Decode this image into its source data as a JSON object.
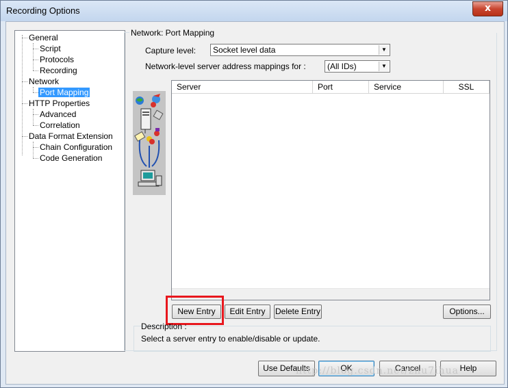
{
  "window": {
    "title": "Recording Options",
    "close_glyph": "x"
  },
  "tree": {
    "items": [
      {
        "label": "General"
      },
      {
        "label": "Script"
      },
      {
        "label": "Protocols"
      },
      {
        "label": "Recording"
      },
      {
        "label": "Network"
      },
      {
        "label": "Port Mapping",
        "selected": true
      },
      {
        "label": "HTTP Properties"
      },
      {
        "label": "Advanced"
      },
      {
        "label": "Correlation"
      },
      {
        "label": "Data Format Extension"
      },
      {
        "label": "Chain Configuration"
      },
      {
        "label": "Code Generation"
      }
    ]
  },
  "section": {
    "title": "Network: Port Mapping"
  },
  "capture": {
    "label": "Capture level:",
    "value": "Socket level data"
  },
  "mapping": {
    "label": "Network-level server address mappings for :",
    "value": "(All IDs)"
  },
  "list": {
    "columns": [
      "Server",
      "Port",
      "Service",
      "SSL"
    ],
    "rows": []
  },
  "buttons": {
    "new_entry": "New Entry",
    "edit_entry": "Edit Entry",
    "delete_entry": "Delete Entry",
    "options": "Options..."
  },
  "description": {
    "label": "Description :",
    "text": "Select a server entry to enable/disable or update."
  },
  "footer": {
    "use_defaults": "Use Defaults",
    "ok": "OK",
    "cancel": "Cancel",
    "help": "Help"
  },
  "watermark": "http://blog.csdn.net/zhu7ihua",
  "colors": {
    "selection": "#3399ff",
    "highlight_box": "#e8171d",
    "close_button": "#c8452f"
  }
}
